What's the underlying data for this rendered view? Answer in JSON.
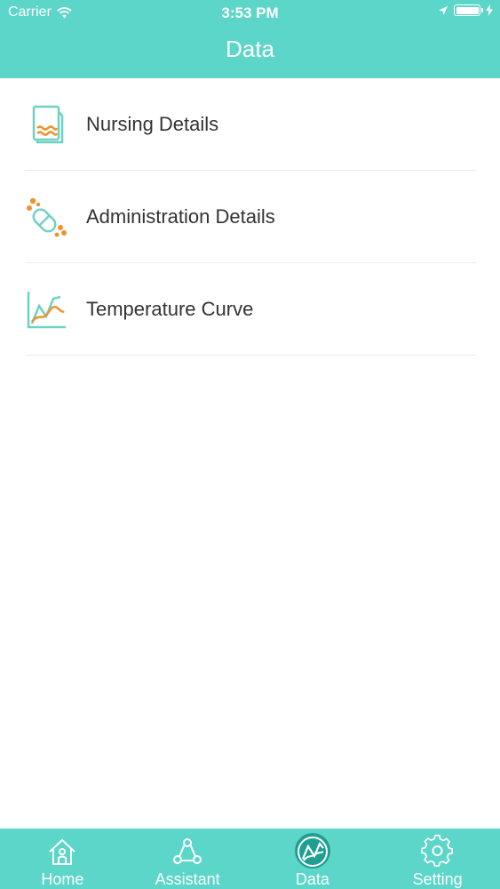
{
  "status_bar": {
    "carrier": "Carrier",
    "time": "3:53 PM"
  },
  "nav": {
    "title": "Data"
  },
  "items": [
    {
      "label": "Nursing Details",
      "icon": "nursing-document-icon"
    },
    {
      "label": "Administration Details",
      "icon": "pill-capsule-icon"
    },
    {
      "label": "Temperature Curve",
      "icon": "line-chart-icon"
    }
  ],
  "tabs": [
    {
      "label": "Home",
      "icon": "home-icon",
      "active": false
    },
    {
      "label": "Assistant",
      "icon": "assistant-icon",
      "active": false
    },
    {
      "label": "Data",
      "icon": "data-chart-icon",
      "active": true
    },
    {
      "label": "Setting",
      "icon": "gear-icon",
      "active": false
    }
  ],
  "colors": {
    "accent": "#5cd6c8",
    "active_tab": "#1e9f92",
    "icon_teal": "#6fd1c4",
    "icon_orange": "#f0922b"
  }
}
